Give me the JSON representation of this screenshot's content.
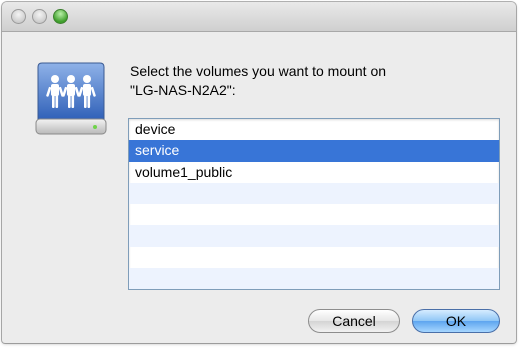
{
  "dialog": {
    "prompt_line1": "Select the volumes you want to mount on",
    "prompt_line2": "\"LG-NAS-N2A2\":"
  },
  "volumes": [
    {
      "label": "device",
      "selected": false
    },
    {
      "label": "service",
      "selected": true
    },
    {
      "label": "volume1_public",
      "selected": false
    }
  ],
  "buttons": {
    "cancel_label": "Cancel",
    "ok_label": "OK"
  },
  "icons": {
    "window_close": "close-icon",
    "window_minimize": "minimize-icon",
    "window_zoom": "zoom-icon",
    "server": "network-server-icon"
  },
  "colors": {
    "selection": "#3875d7",
    "alt_row": "#edf3fe",
    "zoom_button": "#3f9f2c",
    "default_button": "#5ea5ef"
  }
}
